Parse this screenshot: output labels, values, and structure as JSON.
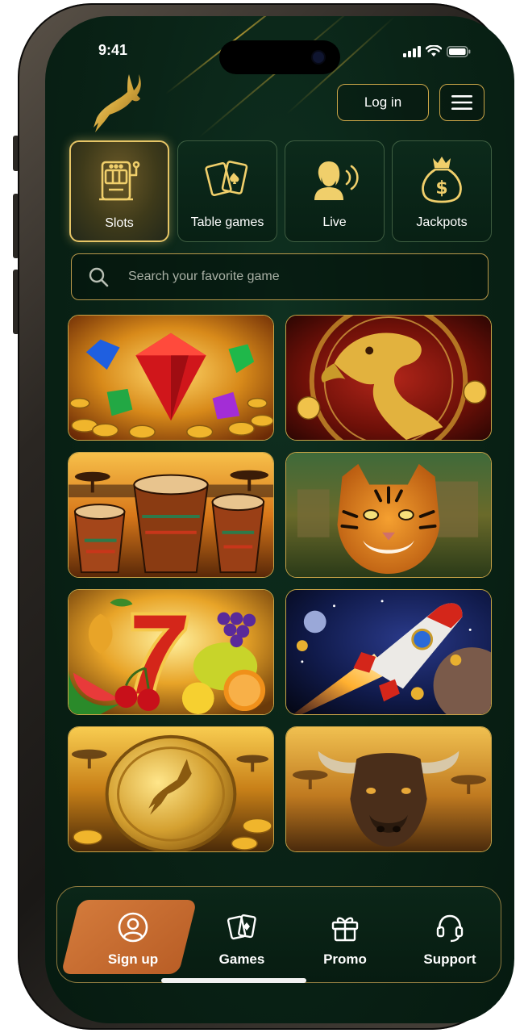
{
  "status_bar": {
    "time": "9:41"
  },
  "header": {
    "login_label": "Log in"
  },
  "categories": [
    {
      "label": "Slots",
      "icon": "slot-machine-icon",
      "active": true
    },
    {
      "label": "Table games",
      "icon": "playing-cards-icon",
      "active": false
    },
    {
      "label": "Live",
      "icon": "live-dealer-icon",
      "active": false
    },
    {
      "label": "Jackpots",
      "icon": "money-bag-icon",
      "active": false
    }
  ],
  "search": {
    "placeholder": "Search your favorite game"
  },
  "games": [
    {
      "theme": "gems-and-gold-coins"
    },
    {
      "theme": "golden-dragon"
    },
    {
      "theme": "african-drums"
    },
    {
      "theme": "jungle-tiger"
    },
    {
      "theme": "fruits-lucky-seven"
    },
    {
      "theme": "space-rocket"
    },
    {
      "theme": "gold-coin-antelope"
    },
    {
      "theme": "savanna-buffalo"
    }
  ],
  "bottom_nav": [
    {
      "label": "Sign up",
      "icon": "user-icon",
      "active": true
    },
    {
      "label": "Games",
      "icon": "cards-icon",
      "active": false
    },
    {
      "label": "Promo",
      "icon": "gift-icon",
      "active": false
    },
    {
      "label": "Support",
      "icon": "headset-icon",
      "active": false
    }
  ],
  "colors": {
    "accent_gold": "#c9a447",
    "background": "#0a2417",
    "signup_orange": "#c96a2e"
  }
}
